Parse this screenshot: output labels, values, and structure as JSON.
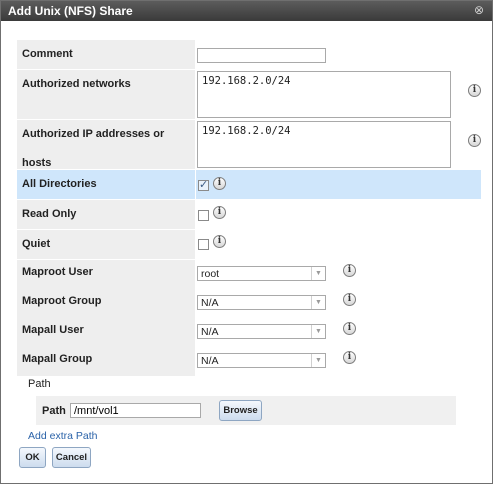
{
  "dialog": {
    "title": "Add Unix (NFS) Share",
    "close_glyph": "⊗"
  },
  "form": {
    "comment": {
      "label": "Comment",
      "value": ""
    },
    "networks": {
      "label": "Authorized networks",
      "value": "192.168.2.0/24"
    },
    "hosts": {
      "label": "Authorized IP addresses or hosts",
      "value": "192.168.2.0/24"
    },
    "all_dirs": {
      "label": "All Directories",
      "checked": true
    },
    "read_only": {
      "label": "Read Only",
      "checked": false
    },
    "quiet": {
      "label": "Quiet",
      "checked": false
    },
    "maproot_user": {
      "label": "Maproot User",
      "value": "root"
    },
    "maproot_group": {
      "label": "Maproot Group",
      "value": "N/A"
    },
    "mapall_user": {
      "label": "Mapall User",
      "value": "N/A"
    },
    "mapall_group": {
      "label": "Mapall Group",
      "value": "N/A"
    },
    "info_glyph": "i",
    "select_arrow": "▼"
  },
  "path_section": {
    "heading": "Path",
    "label": "Path",
    "value": "/mnt/vol1",
    "browse_label": "Browse",
    "add_extra_label": "Add extra Path"
  },
  "buttons": {
    "ok": "OK",
    "cancel": "Cancel"
  }
}
